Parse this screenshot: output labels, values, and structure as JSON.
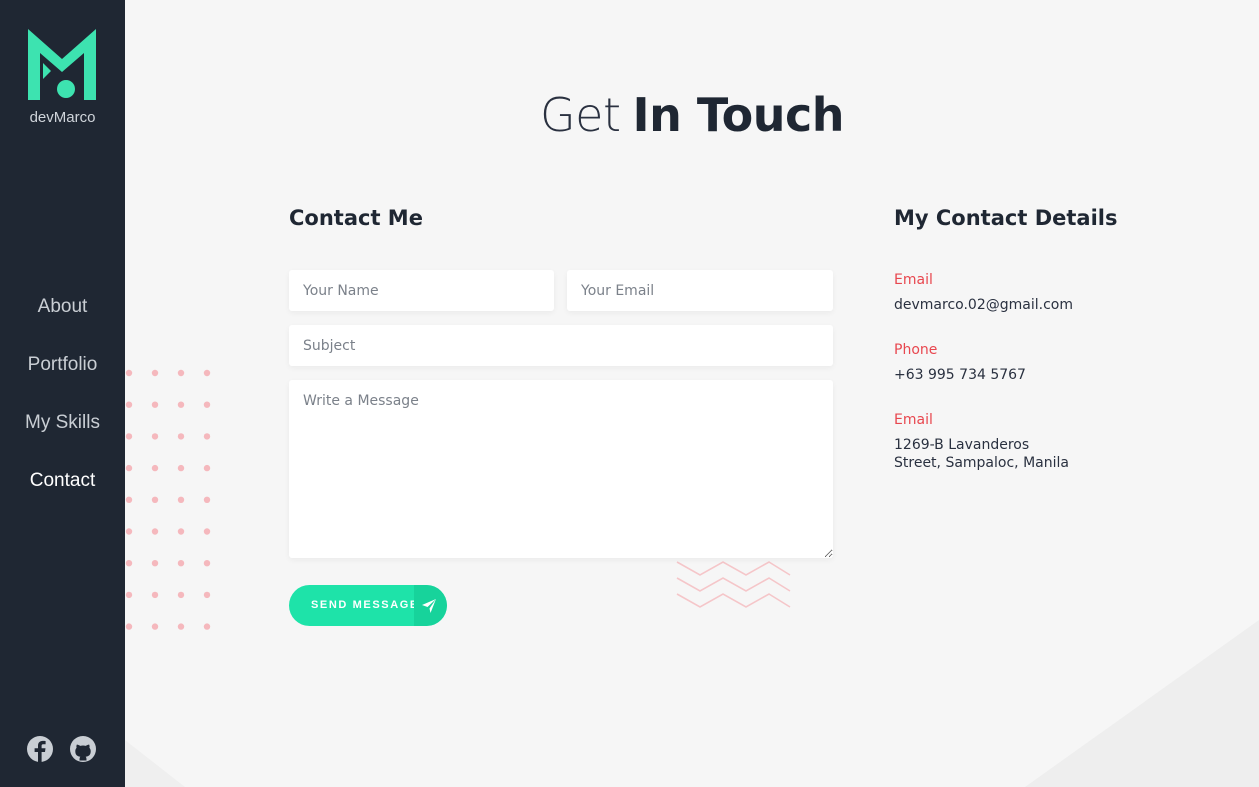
{
  "brand": {
    "name": "devMarco"
  },
  "nav": {
    "items": [
      {
        "label": "About"
      },
      {
        "label": "Portfolio"
      },
      {
        "label": "My Skills"
      },
      {
        "label": "Contact"
      }
    ],
    "active": "Contact"
  },
  "social": {
    "icons": [
      "facebook-icon",
      "github-icon"
    ]
  },
  "page": {
    "title_light": "Get",
    "title_bold": "In Touch"
  },
  "form": {
    "title": "Contact Me",
    "name_placeholder": "Your Name",
    "email_placeholder": "Your Email",
    "subject_placeholder": "Subject",
    "message_placeholder": "Write a Message",
    "submit_label": "SEND MESSAGE",
    "submit_icon": "paper-plane-icon"
  },
  "details": {
    "title": "My Contact Details",
    "items": [
      {
        "label": "Email",
        "value": "devmarco.02@gmail.com"
      },
      {
        "label": "Phone",
        "value": "+63 995 734 5767"
      },
      {
        "label": "Email",
        "value_line1": "1269-B Lavanderos",
        "value_line2": "Street, Sampaloc, Manila"
      }
    ]
  },
  "colors": {
    "sidebar": "#1f2733",
    "accent": "#1ee3a9",
    "label_red": "#e8474f",
    "background": "#f6f6f6",
    "decor_pink": "#f5b8bd"
  }
}
